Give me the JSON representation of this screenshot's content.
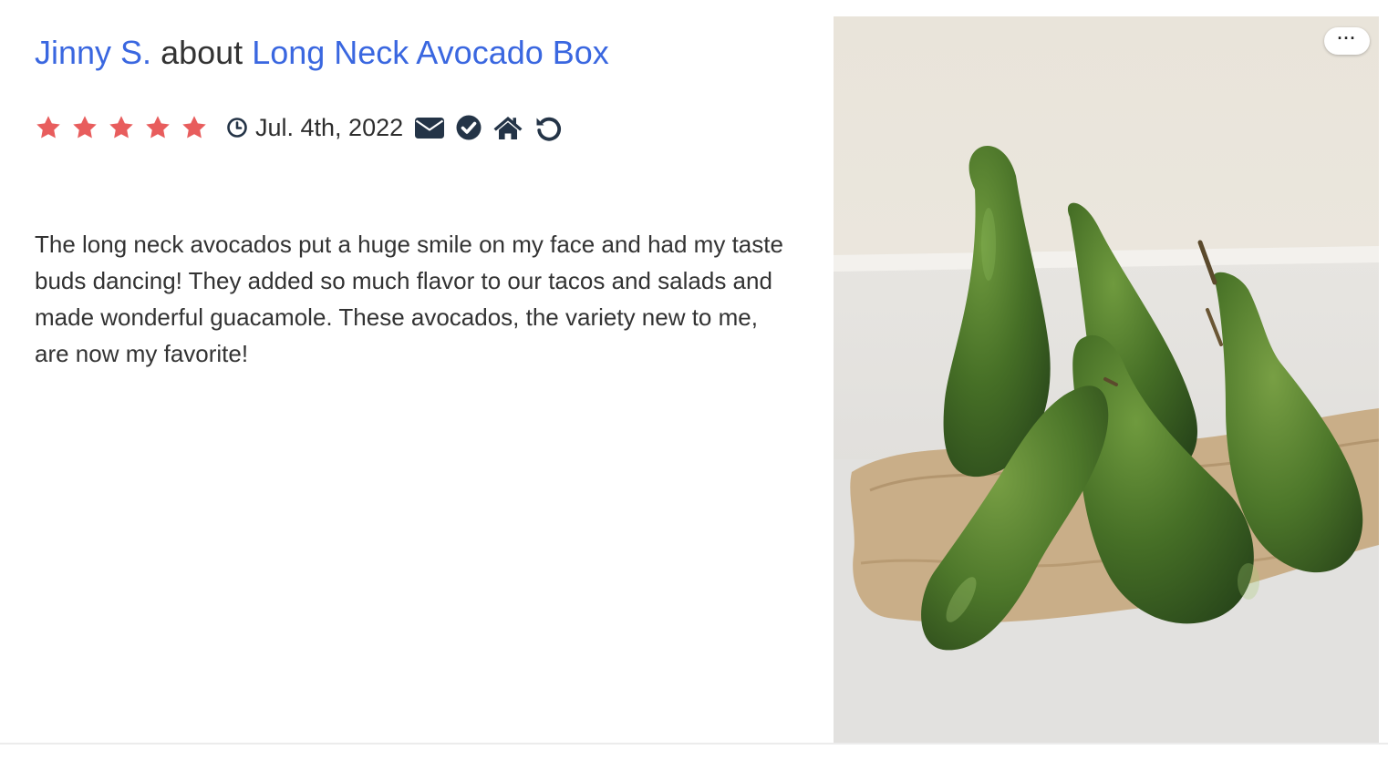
{
  "review": {
    "reviewer": "Jinny S.",
    "connector": "about",
    "product": "Long Neck Avocado Box",
    "rating": 5,
    "rating_max": 5,
    "date": "Jul. 4th, 2022",
    "body": "The long neck avocados put a huge smile on my face and had my taste buds dancing! They added so much flavor to our tacos and salads and made wonderful guacamole. These avocados, the variety new to me, are now my favorite!"
  },
  "icons": {
    "star": "star-icon",
    "date": "clock-icon",
    "meta": [
      "envelope-icon",
      "check-circle-icon",
      "home-icon",
      "undo-icon"
    ],
    "photo_menu": "more-horizontal-icon"
  },
  "photo": {
    "menu_label": "···",
    "subject": "long neck avocados"
  },
  "colors": {
    "link": "#3a67e0",
    "star": "#e85d5d",
    "text": "#333333",
    "icon": "#243447"
  }
}
